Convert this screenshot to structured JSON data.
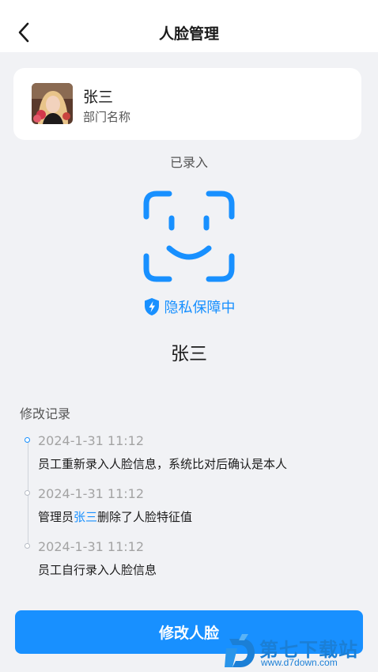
{
  "header": {
    "title": "人脸管理"
  },
  "user": {
    "name": "张三",
    "department": "部门名称"
  },
  "face": {
    "status": "已录入",
    "privacy_label": "隐私保障中",
    "name": "张三"
  },
  "history": {
    "title": "修改记录",
    "records": [
      {
        "time": "2024-1-31 11:12",
        "text": "员工重新录入人脸信息，系统比对后确认是本人"
      },
      {
        "time": "2024-1-31 11:12",
        "text_before": "管理员",
        "highlight": "张三",
        "text_after": "删除了人脸特征值"
      },
      {
        "time": "2024-1-31 11:12",
        "text": "员工自行录入人脸信息"
      }
    ]
  },
  "action": {
    "label": "修改人脸"
  },
  "watermark": {
    "brand": "第七下载站",
    "url": "www.d7down.com"
  },
  "colors": {
    "accent": "#1890ff",
    "background": "#f1f2f5"
  }
}
